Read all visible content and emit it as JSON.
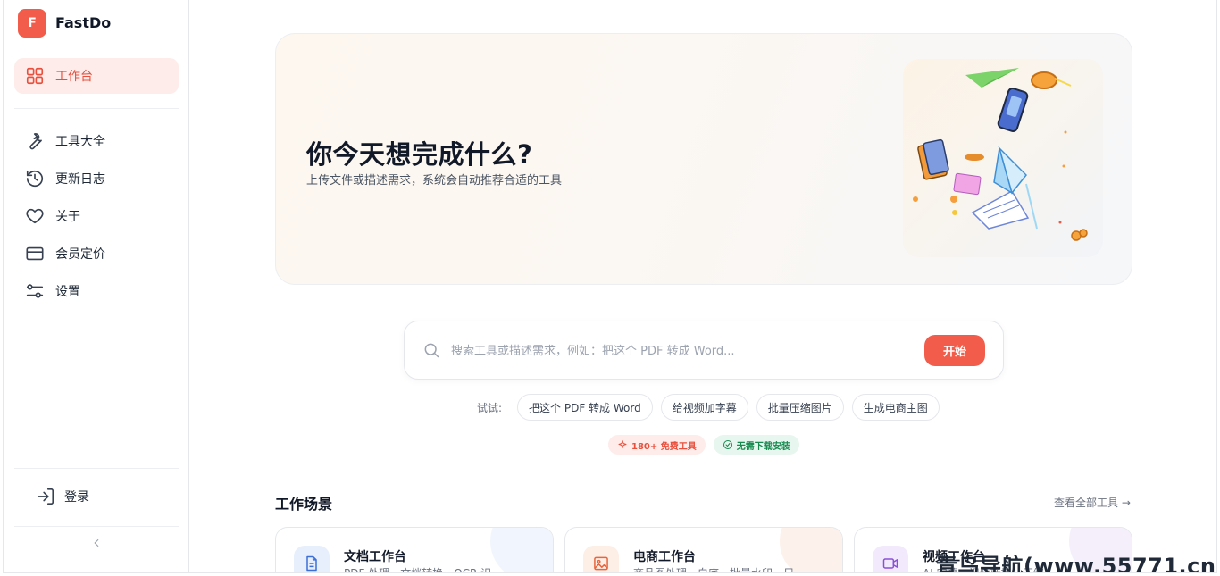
{
  "brand": {
    "logo_letter": "F",
    "name": "FastDo",
    "color": "#f25c4a"
  },
  "sidebar": {
    "active": {
      "label": "工作台",
      "icon": "grid-icon"
    },
    "items": [
      {
        "label": "工具大全",
        "icon": "wrench-icon"
      },
      {
        "label": "更新日志",
        "icon": "history-icon"
      },
      {
        "label": "关于",
        "icon": "heart-icon"
      },
      {
        "label": "会员定价",
        "icon": "credit-card-icon"
      },
      {
        "label": "设置",
        "icon": "sliders-icon"
      }
    ],
    "login_label": "登录",
    "collapse_icon": "chevron-left-icon"
  },
  "hero": {
    "title": "你今天想完成什么?",
    "subtitle": "上传文件或描述需求，系统会自动推荐合适的工具"
  },
  "search": {
    "placeholder": "搜索工具或描述需求，例如：把这个 PDF 转成 Word...",
    "value": "",
    "button_label": "开始"
  },
  "suggestions": {
    "label": "试试:",
    "chips": [
      "把这个 PDF 转成 Word",
      "给视频加字幕",
      "批量压缩图片",
      "生成电商主图"
    ]
  },
  "badges": [
    {
      "text": "180+ 免费工具",
      "icon": "sparkle-icon",
      "color": "#e8503d"
    },
    {
      "text": "无需下载安装",
      "icon": "check-circle-icon",
      "color": "#168a4f"
    }
  ],
  "scenes": {
    "title": "工作场景",
    "view_all": "查看全部工具 →",
    "cards": [
      {
        "title": "文档工作台",
        "desc": "PDF 处理、文档转换、OCR 识...",
        "icon": "document-icon",
        "color": "#3b6fd8",
        "bg": "#e8effc"
      },
      {
        "title": "电商工作台",
        "desc": "商品图处理、白底、批量水印、尺...",
        "icon": "image-icon",
        "color": "#e8663d",
        "bg": "#fdeee6"
      },
      {
        "title": "视频工作台",
        "desc": "AI 字幕、视频转换、压缩...",
        "icon": "video-icon",
        "color": "#8b4fd8",
        "bg": "#f2eafc"
      }
    ]
  },
  "watermark": "青鸟导航(www.55771.cn)"
}
